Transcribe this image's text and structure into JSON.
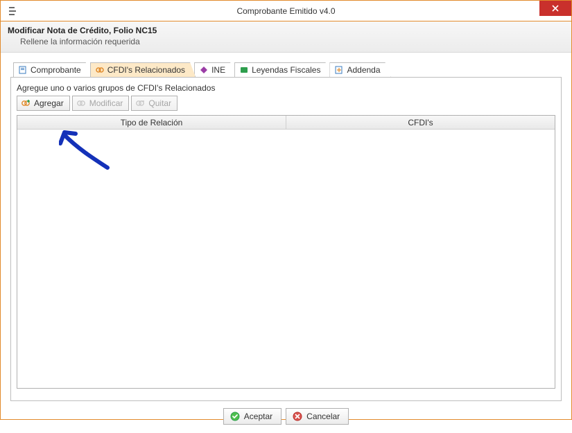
{
  "window": {
    "title": "Comprobante Emitido v4.0"
  },
  "header": {
    "title": "Modificar Nota de Crédito, Folio NC15",
    "subtitle": "Rellene la información requerida"
  },
  "tabs": [
    {
      "label": "Comprobante",
      "icon": "document-icon",
      "active": false
    },
    {
      "label": "CFDI's Relacionados",
      "icon": "link-icon",
      "active": true
    },
    {
      "label": "INE",
      "icon": "diamond-icon",
      "active": false
    },
    {
      "label": "Leyendas Fiscales",
      "icon": "note-icon",
      "active": false
    },
    {
      "label": "Addenda",
      "icon": "addenda-icon",
      "active": false
    }
  ],
  "panel": {
    "instruction": "Agregue uno o varios grupos de CFDI's Relacionados",
    "toolbar": {
      "agregar": "Agregar",
      "modificar": "Modificar",
      "quitar": "Quitar"
    },
    "columns": [
      "Tipo de Relación",
      "CFDI's"
    ],
    "rows": []
  },
  "footer": {
    "accept": "Aceptar",
    "cancel": "Cancelar"
  }
}
